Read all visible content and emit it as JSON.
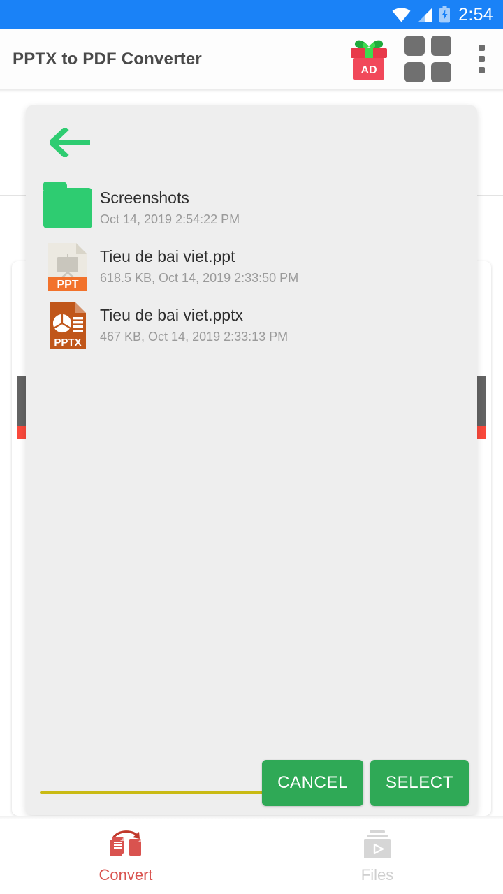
{
  "status_bar": {
    "time": "2:54",
    "icons": [
      "wifi-icon",
      "signal-icon",
      "battery-charging-icon"
    ],
    "background_color": "#1a82f7"
  },
  "app_bar": {
    "title": "PPTX to PDF Converter",
    "gift_ad_label": "AD",
    "gift_icon": "gift-ad-icon",
    "grid_icon": "grid-apps-icon",
    "overflow_icon": "more-vertical-icon"
  },
  "dialog": {
    "back_icon": "back-arrow-icon",
    "items": [
      {
        "type": "folder",
        "icon": "folder-icon",
        "name": "Screenshots",
        "meta": "Oct 14, 2019 2:54:22 PM",
        "badge": ""
      },
      {
        "type": "file",
        "icon": "ppt-file-icon",
        "name": "Tieu de bai viet.ppt",
        "meta": "618.5 KB, Oct 14, 2019 2:33:50 PM",
        "badge": "PPT"
      },
      {
        "type": "file",
        "icon": "pptx-file-icon",
        "name": "Tieu de bai viet.pptx",
        "meta": "467 KB, Oct 14, 2019 2:33:13 PM",
        "badge": "PPTX"
      }
    ],
    "cancel_label": "CANCEL",
    "select_label": "SELECT",
    "button_color": "#2fa956",
    "background_color": "#eeeeee",
    "accent_line_color": "#c9ba13"
  },
  "bottom_nav": {
    "items": [
      {
        "label": "Convert",
        "icon": "convert-icon",
        "active": true
      },
      {
        "label": "Files",
        "icon": "files-play-icon",
        "active": false
      }
    ],
    "active_color": "#d9534f",
    "inactive_color": "#cfcfcf"
  },
  "scrollbars": {
    "thumb_color": "#636363",
    "tip_color": "#f9483b"
  }
}
